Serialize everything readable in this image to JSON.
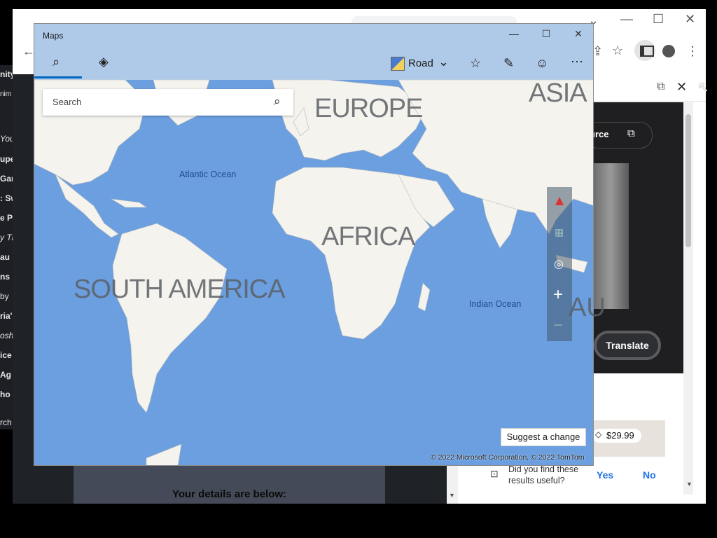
{
  "maps": {
    "title": "Maps",
    "view_mode": "Road",
    "search_placeholder": "Search",
    "suggest_change": "Suggest a change",
    "copyright": "© 2022 Microsoft Corporation, © 2022 TomTom",
    "labels": {
      "europe": "EUROPE",
      "asia": "ASIA",
      "africa": "AFRICA",
      "south_america": "SOUTH AMERICA",
      "atlantic": "Atlantic Ocean",
      "indian": "Indian Ocean",
      "australia_partial": "AU"
    },
    "colors": {
      "ocean": "#6b9fe0",
      "land": "#f4f3ee",
      "accent": "#0067c0"
    }
  },
  "browser": {
    "side_panel": {
      "source_label": "urce",
      "translate": "Translate",
      "price": "$29.99",
      "feedback_question": "Did you find these results useful?",
      "feedback_yes": "Yes",
      "feedback_no": "No"
    },
    "page": {
      "details_text": "Your details are below:"
    },
    "left_strip": [
      "nity",
      "nim",
      "You",
      "upe",
      "Gar",
      ": Sw",
      "e Po",
      "y Th",
      "au",
      "ns",
      "by",
      "ria'",
      "osh",
      "ice",
      "Ag",
      "ho",
      "rch"
    ]
  }
}
